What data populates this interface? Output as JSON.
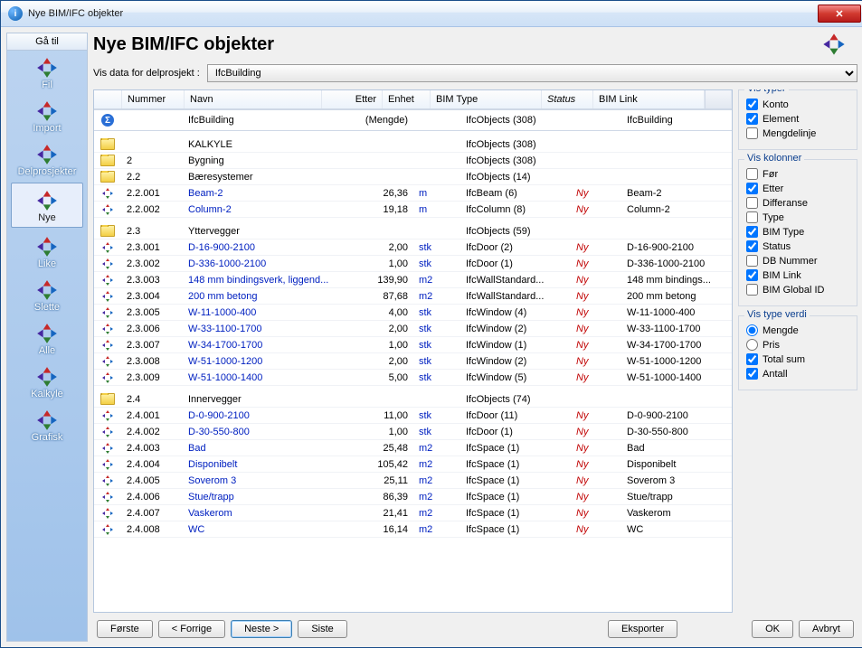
{
  "title": "Nye BIM/IFC objekter",
  "heading": "Nye BIM/IFC objekter",
  "vis_label": "Vis data for delprosjekt :",
  "vis_value": "IfcBuilding",
  "sidebar": {
    "header": "Gå til",
    "items": [
      {
        "label": "Fil"
      },
      {
        "label": "Import"
      },
      {
        "label": "Delprosjekter"
      },
      {
        "label": "Nye",
        "selected": true
      },
      {
        "label": "Like"
      },
      {
        "label": "Slette"
      },
      {
        "label": "Alle"
      },
      {
        "label": "Kalkyle"
      },
      {
        "label": "Grafisk"
      }
    ]
  },
  "columns": {
    "nummer": "Nummer",
    "navn": "Navn",
    "etter": "Etter",
    "enhet": "Enhet",
    "bim": "BIM Type",
    "status": "Status",
    "link": "BIM Link"
  },
  "rows": [
    {
      "t": "sum",
      "num": "",
      "navn": "IfcBuilding",
      "etter": "(Mengde)",
      "enhet": "",
      "bim": "IfcObjects (308)",
      "status": "",
      "link": "IfcBuilding"
    },
    {
      "t": "sep"
    },
    {
      "t": "fold",
      "num": "",
      "navn": "KALKYLE",
      "bim": "IfcObjects (308)"
    },
    {
      "t": "fold",
      "num": "2",
      "navn": "Bygning",
      "bim": "IfcObjects (308)"
    },
    {
      "t": "fold",
      "num": "2.2",
      "navn": "Bæresystemer",
      "bim": "IfcObjects (14)"
    },
    {
      "t": "item",
      "num": "2.2.001",
      "navn": "Beam-2",
      "etter": "26,36",
      "enhet": "m",
      "bim": "IfcBeam (6)",
      "status": "Ny",
      "link": "Beam-2"
    },
    {
      "t": "item",
      "num": "2.2.002",
      "navn": "Column-2",
      "etter": "19,18",
      "enhet": "m",
      "bim": "IfcColumn (8)",
      "status": "Ny",
      "link": "Column-2"
    },
    {
      "t": "sep"
    },
    {
      "t": "fold",
      "num": "2.3",
      "navn": "Yttervegger",
      "bim": "IfcObjects (59)"
    },
    {
      "t": "item",
      "num": "2.3.001",
      "navn": "D-16-900-2100",
      "etter": "2,00",
      "enhet": "stk",
      "bim": "IfcDoor (2)",
      "status": "Ny",
      "link": "D-16-900-2100"
    },
    {
      "t": "item",
      "num": "2.3.002",
      "navn": "D-336-1000-2100",
      "etter": "1,00",
      "enhet": "stk",
      "bim": "IfcDoor (1)",
      "status": "Ny",
      "link": "D-336-1000-2100"
    },
    {
      "t": "item",
      "num": "2.3.003",
      "navn": "148 mm bindingsverk, liggend...",
      "etter": "139,90",
      "enhet": "m2",
      "bim": "IfcWallStandard...",
      "status": "Ny",
      "link": "148 mm bindings..."
    },
    {
      "t": "item",
      "num": "2.3.004",
      "navn": "200 mm betong",
      "etter": "87,68",
      "enhet": "m2",
      "bim": "IfcWallStandard...",
      "status": "Ny",
      "link": "200 mm betong"
    },
    {
      "t": "item",
      "num": "2.3.005",
      "navn": "W-11-1000-400",
      "etter": "4,00",
      "enhet": "stk",
      "bim": "IfcWindow (4)",
      "status": "Ny",
      "link": "W-11-1000-400"
    },
    {
      "t": "item",
      "num": "2.3.006",
      "navn": "W-33-1100-1700",
      "etter": "2,00",
      "enhet": "stk",
      "bim": "IfcWindow (2)",
      "status": "Ny",
      "link": "W-33-1100-1700"
    },
    {
      "t": "item",
      "num": "2.3.007",
      "navn": "W-34-1700-1700",
      "etter": "1,00",
      "enhet": "stk",
      "bim": "IfcWindow (1)",
      "status": "Ny",
      "link": "W-34-1700-1700"
    },
    {
      "t": "item",
      "num": "2.3.008",
      "navn": "W-51-1000-1200",
      "etter": "2,00",
      "enhet": "stk",
      "bim": "IfcWindow (2)",
      "status": "Ny",
      "link": "W-51-1000-1200"
    },
    {
      "t": "item",
      "num": "2.3.009",
      "navn": "W-51-1000-1400",
      "etter": "5,00",
      "enhet": "stk",
      "bim": "IfcWindow (5)",
      "status": "Ny",
      "link": "W-51-1000-1400"
    },
    {
      "t": "sep"
    },
    {
      "t": "fold",
      "num": "2.4",
      "navn": "Innervegger",
      "bim": "IfcObjects (74)"
    },
    {
      "t": "item",
      "num": "2.4.001",
      "navn": "D-0-900-2100",
      "etter": "11,00",
      "enhet": "stk",
      "bim": "IfcDoor (11)",
      "status": "Ny",
      "link": "D-0-900-2100"
    },
    {
      "t": "item",
      "num": "2.4.002",
      "navn": "D-30-550-800",
      "etter": "1,00",
      "enhet": "stk",
      "bim": "IfcDoor (1)",
      "status": "Ny",
      "link": "D-30-550-800"
    },
    {
      "t": "item",
      "num": "2.4.003",
      "navn": "Bad",
      "etter": "25,48",
      "enhet": "m2",
      "bim": "IfcSpace (1)",
      "status": "Ny",
      "link": "Bad"
    },
    {
      "t": "item",
      "num": "2.4.004",
      "navn": "Disponibelt",
      "etter": "105,42",
      "enhet": "m2",
      "bim": "IfcSpace (1)",
      "status": "Ny",
      "link": "Disponibelt"
    },
    {
      "t": "item",
      "num": "2.4.005",
      "navn": "Soverom 3",
      "etter": "25,11",
      "enhet": "m2",
      "bim": "IfcSpace (1)",
      "status": "Ny",
      "link": "Soverom 3"
    },
    {
      "t": "item",
      "num": "2.4.006",
      "navn": "Stue/trapp",
      "etter": "86,39",
      "enhet": "m2",
      "bim": "IfcSpace (1)",
      "status": "Ny",
      "link": "Stue/trapp"
    },
    {
      "t": "item",
      "num": "2.4.007",
      "navn": "Vaskerom",
      "etter": "21,41",
      "enhet": "m2",
      "bim": "IfcSpace (1)",
      "status": "Ny",
      "link": "Vaskerom"
    },
    {
      "t": "item",
      "num": "2.4.008",
      "navn": "WC",
      "etter": "16,14",
      "enhet": "m2",
      "bim": "IfcSpace (1)",
      "status": "Ny",
      "link": "WC"
    }
  ],
  "groups": {
    "typer": {
      "title": "Vis typer",
      "items": [
        {
          "label": "Konto",
          "c": true
        },
        {
          "label": "Element",
          "c": true
        },
        {
          "label": "Mengdelinje",
          "c": false
        }
      ]
    },
    "kolonner": {
      "title": "Vis kolonner",
      "items": [
        {
          "label": "Før",
          "c": false
        },
        {
          "label": "Etter",
          "c": true
        },
        {
          "label": "Differanse",
          "c": false
        },
        {
          "label": "Type",
          "c": false
        },
        {
          "label": "BIM Type",
          "c": true
        },
        {
          "label": "Status",
          "c": true
        },
        {
          "label": "DB Nummer",
          "c": false
        },
        {
          "label": "BIM Link",
          "c": true
        },
        {
          "label": "BIM Global ID",
          "c": false
        }
      ]
    },
    "verdi": {
      "title": "Vis type verdi",
      "radios": [
        {
          "label": "Mengde",
          "c": true
        },
        {
          "label": "Pris",
          "c": false
        }
      ],
      "checks": [
        {
          "label": "Total sum",
          "c": true
        },
        {
          "label": "Antall",
          "c": true
        }
      ]
    }
  },
  "footer": {
    "forste": "Første",
    "forrige": "< Forrige",
    "neste": "Neste >",
    "siste": "Siste",
    "eksporter": "Eksporter",
    "ok": "OK",
    "avbryt": "Avbryt"
  }
}
